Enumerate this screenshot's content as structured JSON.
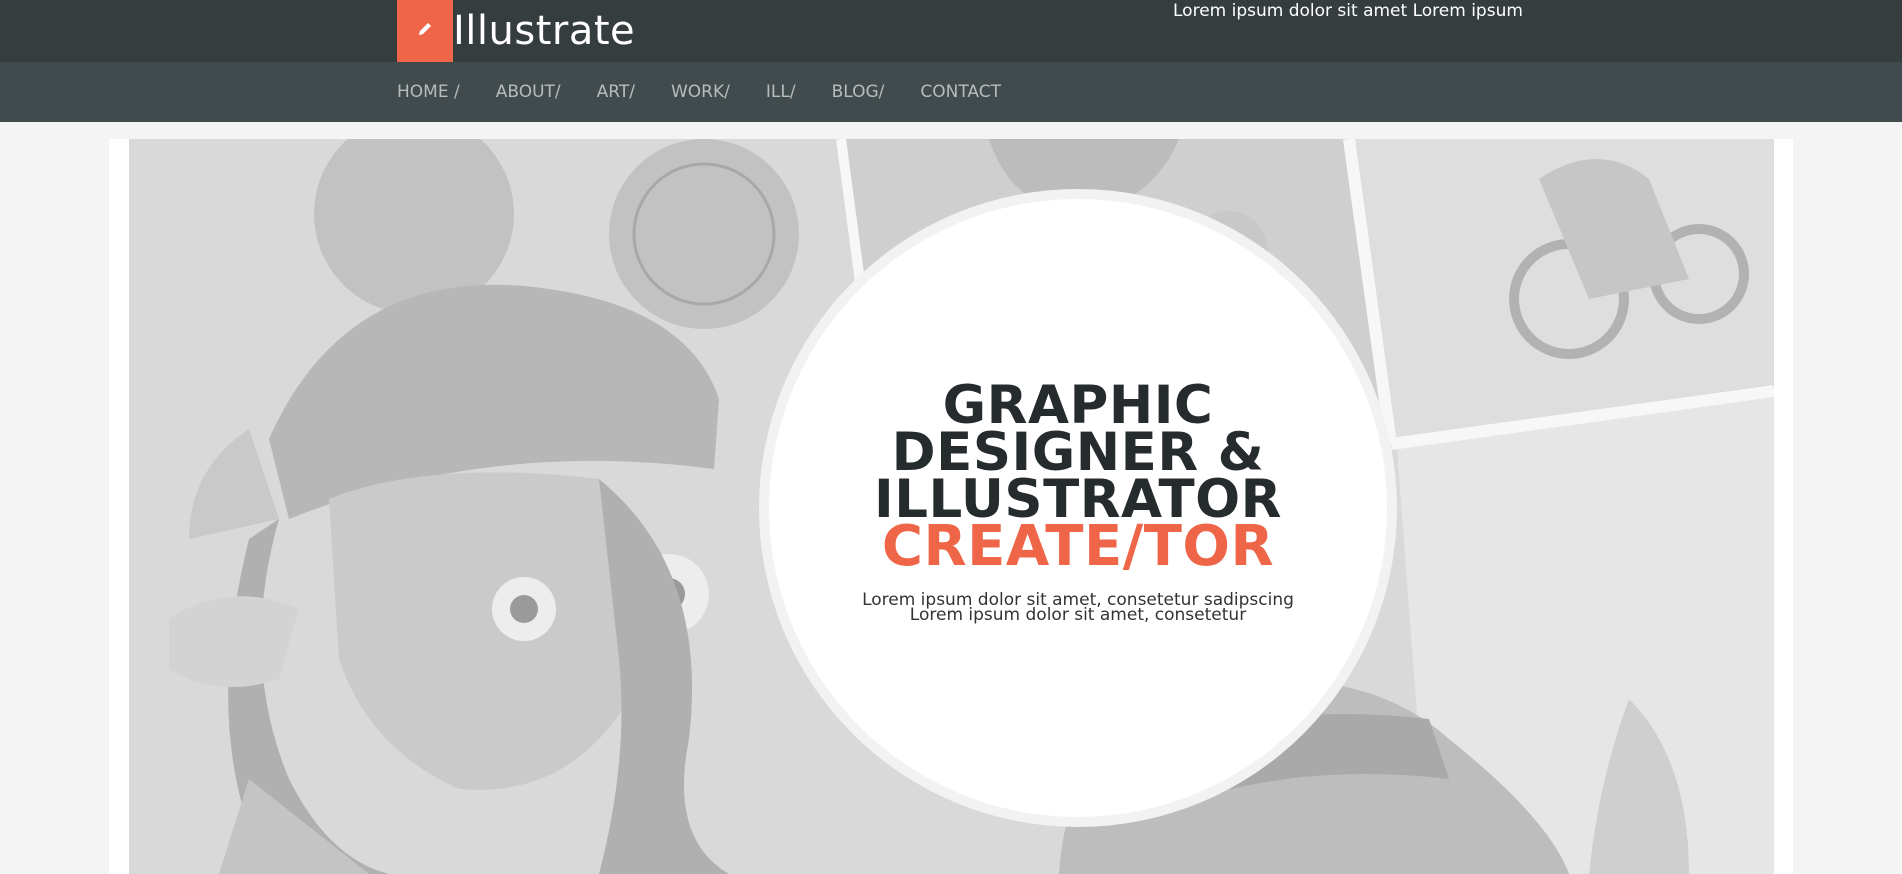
{
  "header": {
    "site_title": "Illustrate",
    "tagline": "Lorem ipsum dolor sit amet Lorem ipsum",
    "logo_icon": "pencil-icon",
    "accent_color": "#ee6547"
  },
  "nav": {
    "items": [
      {
        "label": "HOME /"
      },
      {
        "label": "ABOUT/"
      },
      {
        "label": "ART/"
      },
      {
        "label": "WORK/"
      },
      {
        "label": "ILL/"
      },
      {
        "label": "BLOG/"
      },
      {
        "label": "CONTACT"
      }
    ]
  },
  "hero": {
    "headline_lines": [
      "GRAPHIC",
      "DESIGNER &",
      "ILLUSTRATOR"
    ],
    "accent_line": "CREATE/TOR",
    "sub_lines": [
      "Lorem ipsum dolor sit amet, consetetur sadipscing",
      "Lorem ipsum dolor sit amet, consetetur"
    ]
  }
}
